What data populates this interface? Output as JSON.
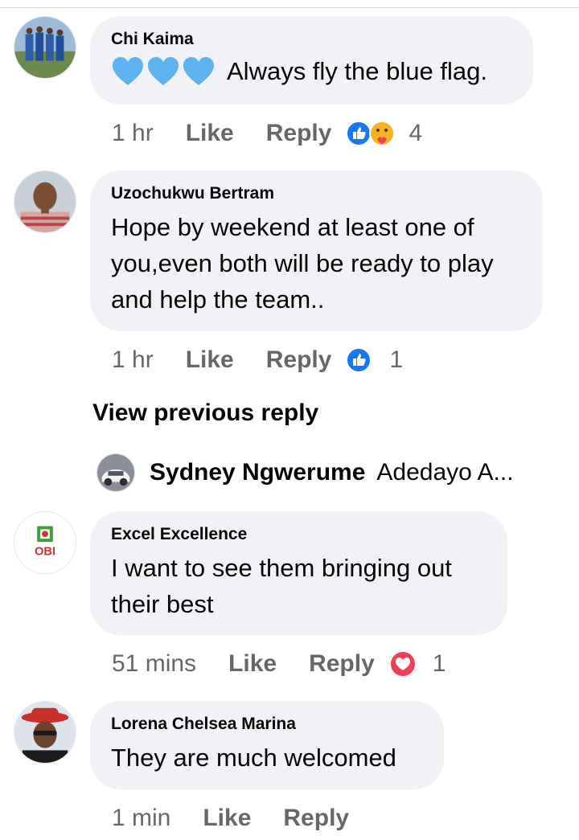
{
  "comments": [
    {
      "author": "Chi Kaima",
      "text": "Always fly the blue flag.",
      "emoji_prefix": [
        "blue-heart",
        "blue-heart",
        "blue-heart"
      ],
      "time": "1 hr",
      "like_label": "Like",
      "reply_label": "Reply",
      "reactions": [
        "like",
        "care"
      ],
      "reaction_count": "4"
    },
    {
      "author": "Uzochukwu Bertram",
      "text_lines": [
        "Hope by weekend at least one of",
        "you,even both will be ready to play",
        "and help the team.."
      ],
      "time": "1 hr",
      "like_label": "Like",
      "reply_label": "Reply",
      "reactions": [
        "like"
      ],
      "reaction_count": "1"
    },
    {
      "author": "Excel Excellence",
      "avatar_text": "OBI",
      "text_lines": [
        "I want to see them bringing out",
        "their best"
      ],
      "time": "51 mins",
      "like_label": "Like",
      "reply_label": "Reply",
      "reactions": [
        "love"
      ],
      "reaction_count": "1"
    },
    {
      "author": "Lorena Chelsea Marina",
      "text": "They are much welcomed",
      "time": "1 min",
      "like_label": "Like",
      "reply_label": "Reply"
    }
  ],
  "view_previous_reply": "View previous reply",
  "reply_preview": {
    "author": "Sydney Ngwerume",
    "text": "Adedayo A..."
  },
  "colors": {
    "bubble": "#f0f2f5",
    "secondary_text": "#65676b",
    "like_blue": "#1877f2",
    "love_red": "#f33e58",
    "care_yellow": "#f7b125"
  }
}
